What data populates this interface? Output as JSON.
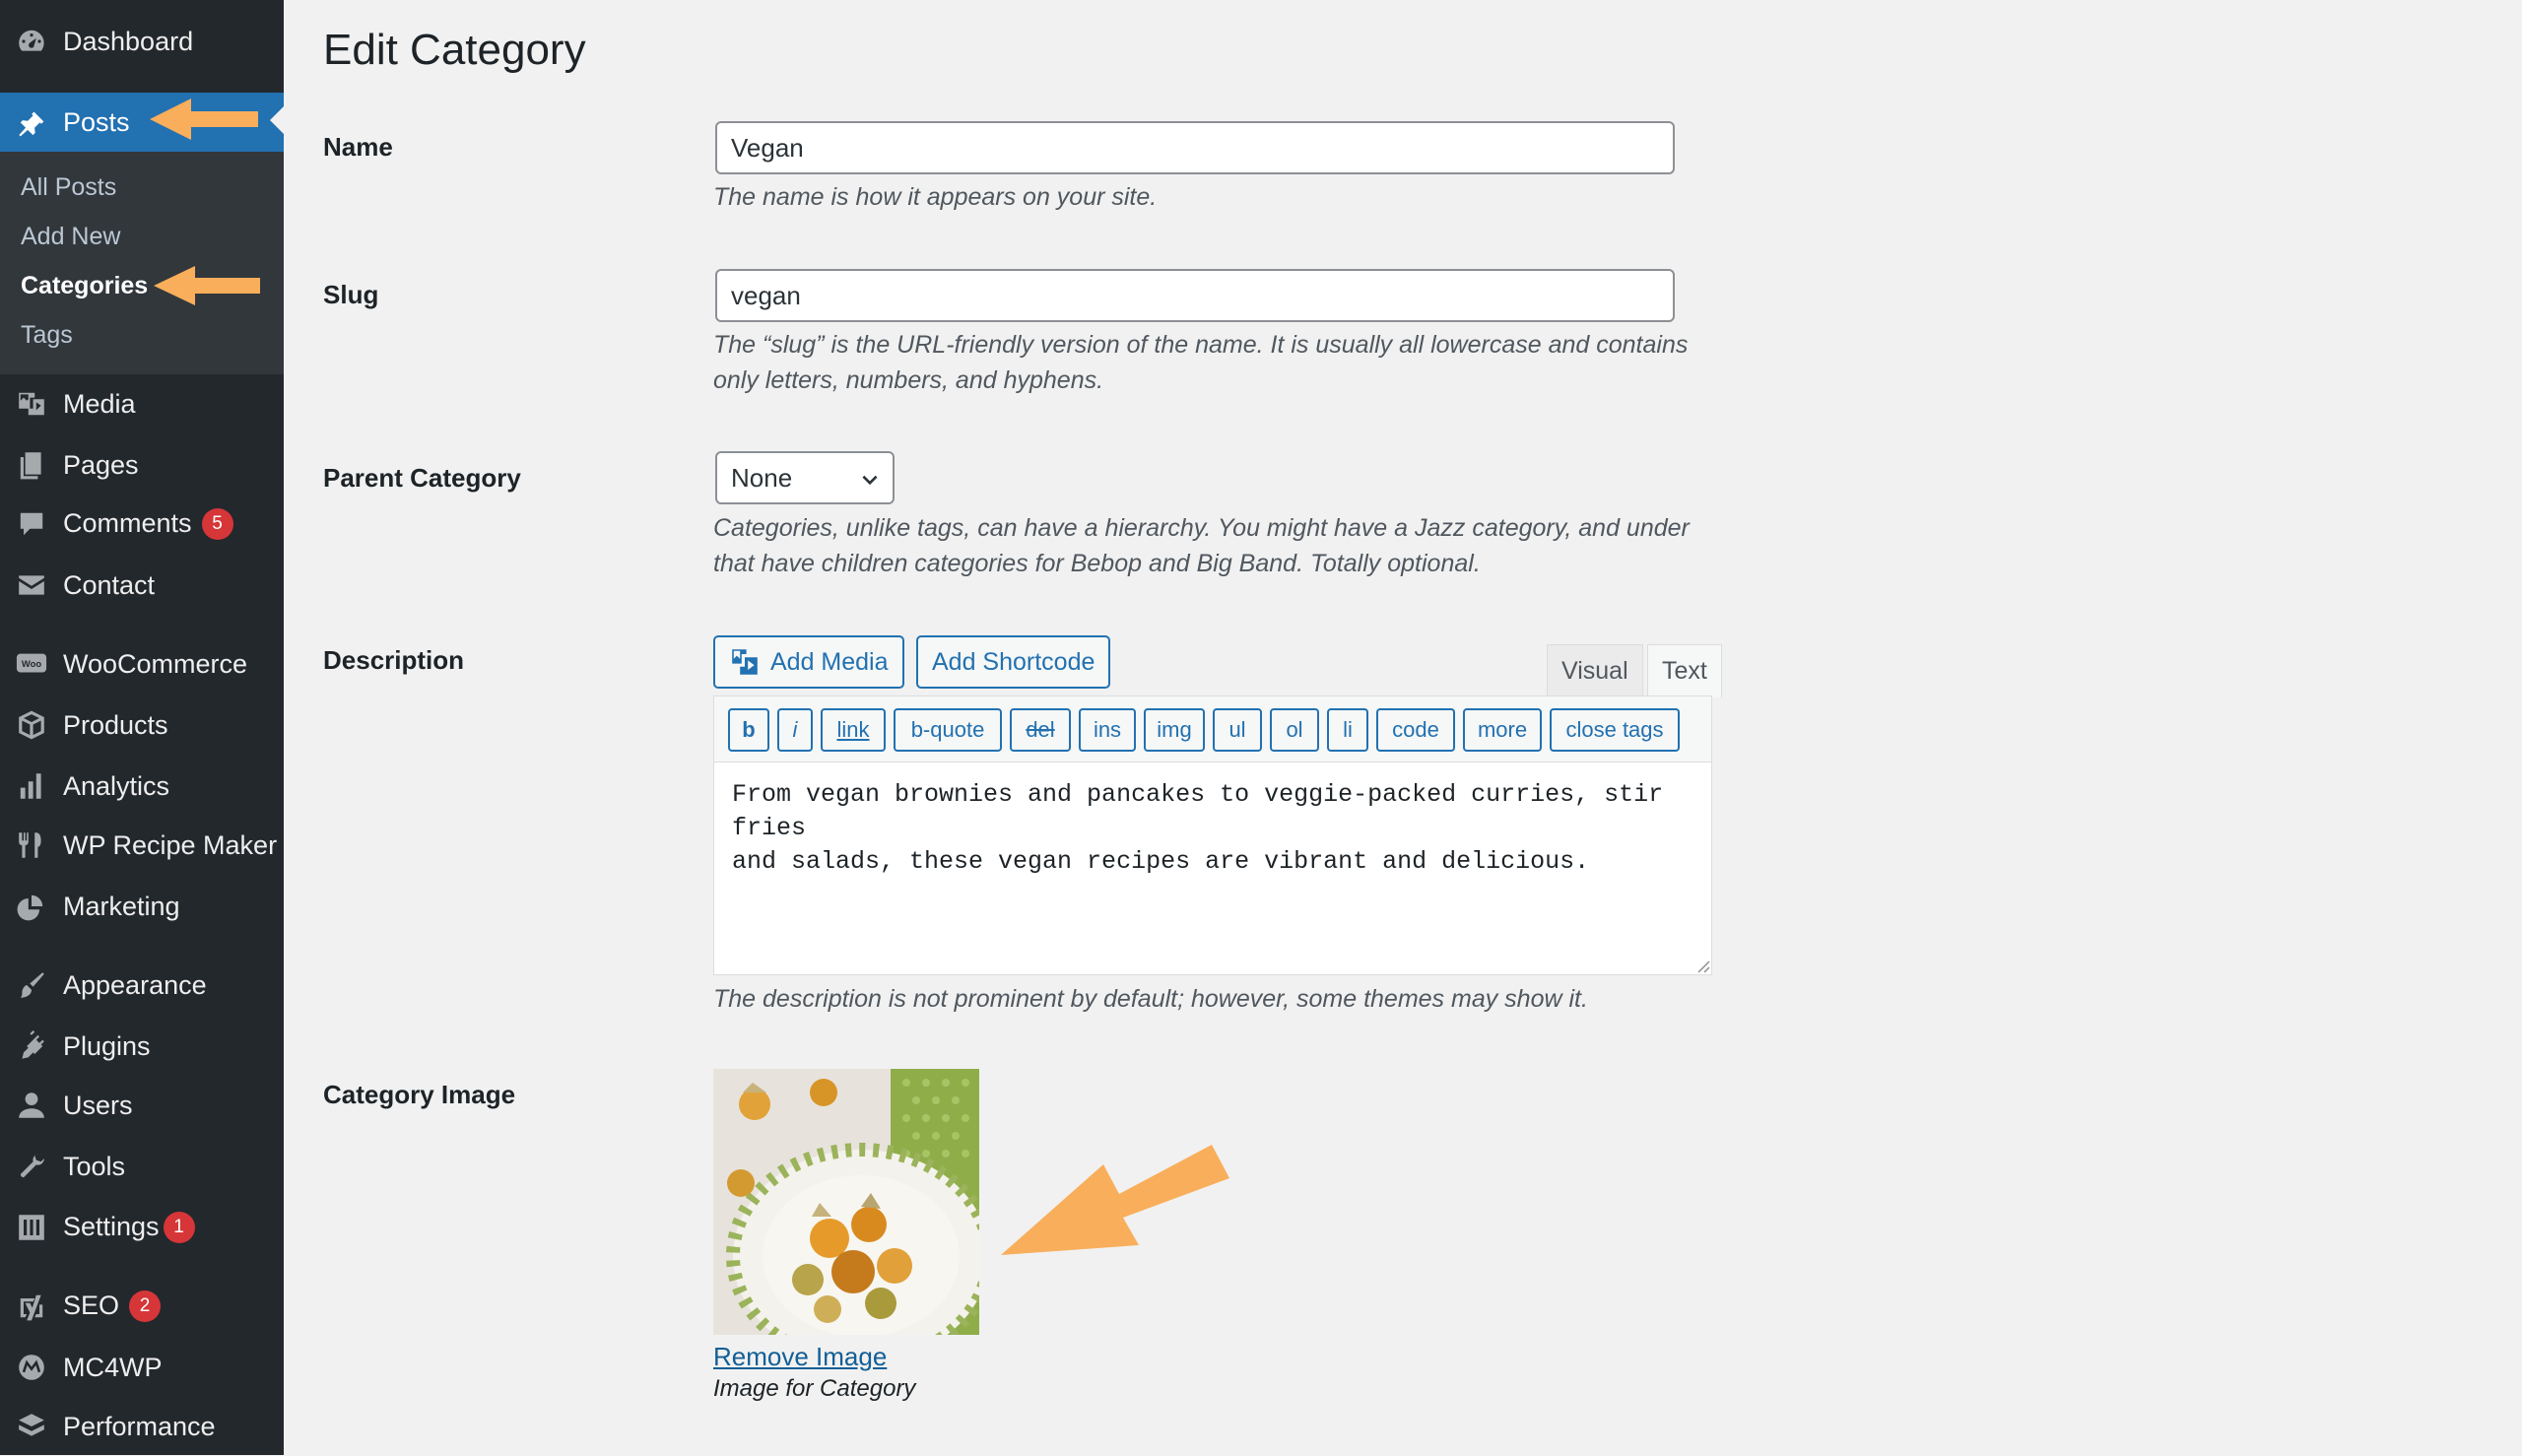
{
  "sidebar": {
    "dashboard": "Dashboard",
    "posts": "Posts",
    "submenu": [
      "All Posts",
      "Add New",
      "Categories",
      "Tags"
    ],
    "media": "Media",
    "pages": "Pages",
    "comments": "Comments",
    "comments_badge": "5",
    "contact": "Contact",
    "woocommerce": "WooCommerce",
    "woo_icon_text": "Woo",
    "products": "Products",
    "analytics": "Analytics",
    "recipe_maker": "WP Recipe Maker",
    "marketing": "Marketing",
    "appearance": "Appearance",
    "plugins": "Plugins",
    "users": "Users",
    "tools": "Tools",
    "settings": "Settings",
    "settings_badge": "1",
    "seo": "SEO",
    "seo_badge": "2",
    "mc4wp": "MC4WP",
    "performance": "Performance"
  },
  "page": {
    "title": "Edit Category"
  },
  "form": {
    "name_label": "Name",
    "name_value": "Vegan",
    "name_help": "The name is how it appears on your site.",
    "slug_label": "Slug",
    "slug_value": "vegan",
    "slug_help": "The “slug” is the URL-friendly version of the name. It is usually all lowercase and contains only letters, numbers, and hyphens.",
    "parent_label": "Parent Category",
    "parent_value": "None",
    "parent_help": "Categories, unlike tags, can have a hierarchy. You might have a Jazz category, and under that have children categories for Bebop and Big Band. Totally optional.",
    "description_label": "Description",
    "add_media": "Add Media",
    "add_shortcode": "Add Shortcode",
    "tab_visual": "Visual",
    "tab_text": "Text",
    "quicktags": [
      "b",
      "i",
      "link",
      "b-quote",
      "del",
      "ins",
      "img",
      "ul",
      "ol",
      "li",
      "code",
      "more",
      "close tags"
    ],
    "description_value": "From vegan brownies and pancakes to veggie-packed curries, stir fries\nand salads, these vegan recipes are vibrant and delicious.",
    "description_help": "The description is not prominent by default; however, some themes may show it.",
    "image_label": "Category Image",
    "remove_image": "Remove Image",
    "image_caption": "Image for Category"
  },
  "colors": {
    "sidebar_bg": "#23282d",
    "active_bg": "#2271b1",
    "annotation_arrow": "#f9ae5b",
    "badge": "#d63638"
  }
}
